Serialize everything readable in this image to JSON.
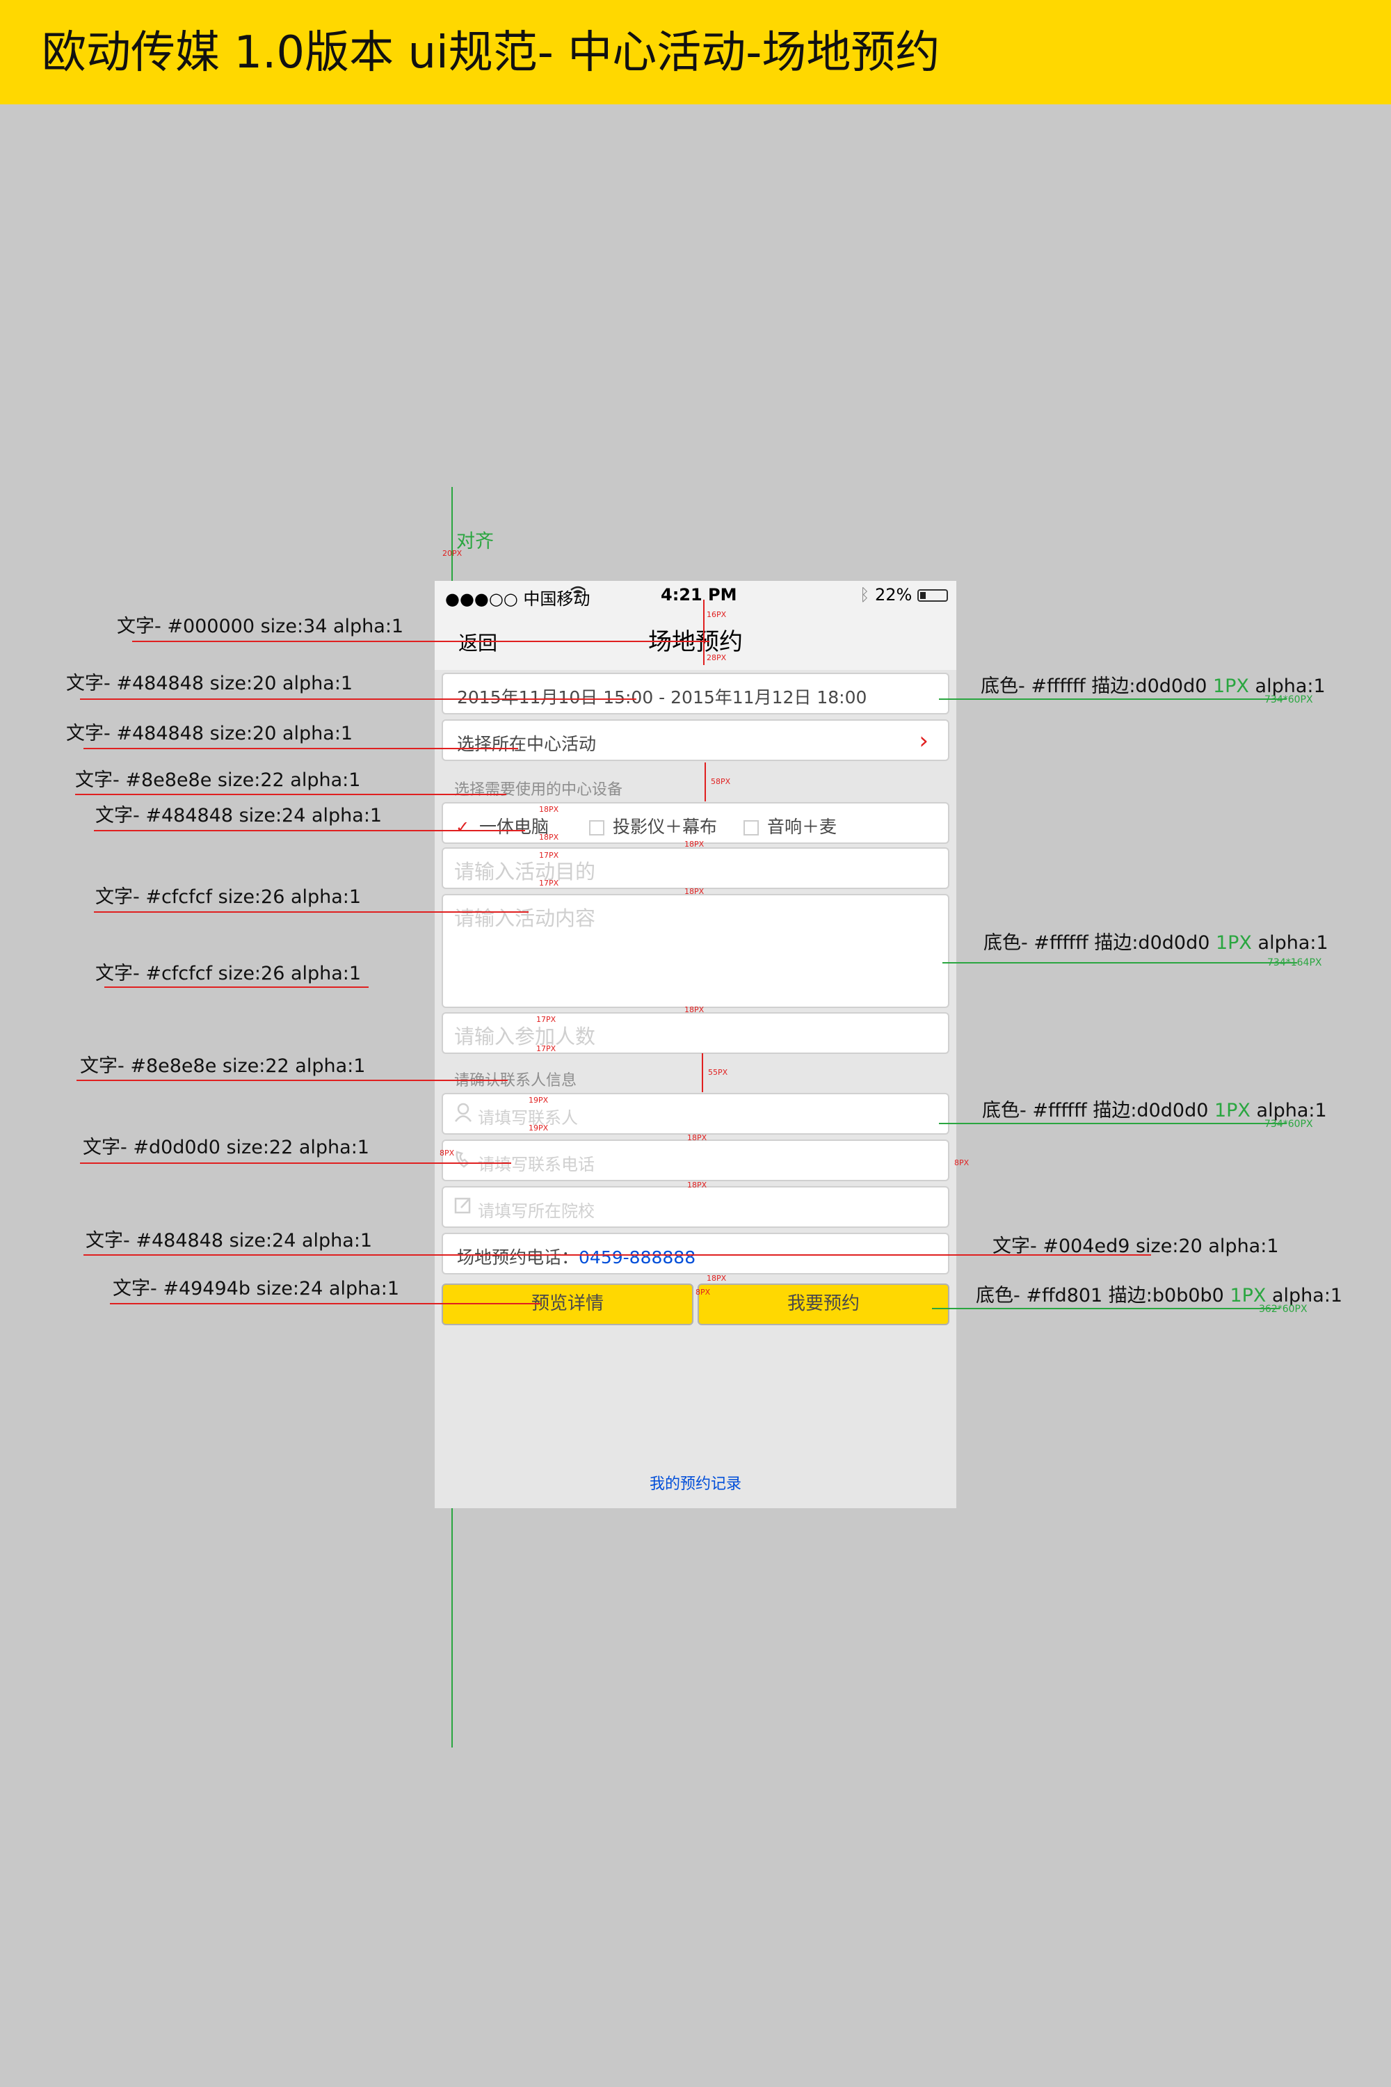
{
  "page": {
    "title": "欧动传媒 1.0版本 ui规范- 中心活动-场地预约",
    "align_label": "对齐"
  },
  "colors": {
    "banner": "#ffd800",
    "canvas": "#c8c8c8",
    "accent": "#ffd801",
    "link": "#004ed9",
    "guide": "#2aa640",
    "marker": "#e02020"
  },
  "status_bar": {
    "carrier": "●●●○○ 中国移动",
    "wifi_icon": "wifi-icon",
    "time": "4:21 PM",
    "bluetooth_icon": "bluetooth-icon",
    "battery": "22%"
  },
  "nav": {
    "back": "返回",
    "title": "场地预约"
  },
  "form": {
    "date_range": "2015年11月10日 15:00 - 2015年11月12日 18:00",
    "select_activity": "选择所在中心活动",
    "equipment_label": "选择需要使用的中心设备",
    "equipment": [
      {
        "label": "一体电脑",
        "checked": true
      },
      {
        "label": "投影仪＋幕布",
        "checked": false
      },
      {
        "label": "音响＋麦",
        "checked": false
      }
    ],
    "purpose_placeholder": "请输入活动目的",
    "content_placeholder": "请输入活动内容",
    "participants_placeholder": "请输入参加人数",
    "contact_label": "请确认联系人信息",
    "contact_name_placeholder": "请填写联系人",
    "contact_phone_placeholder": "请填写联系电话",
    "school_placeholder": "请填写所在院校",
    "venue_phone_label": "场地预约电话：",
    "venue_phone_number": "0459-888888",
    "preview_button": "预览详情",
    "book_button": "我要预约",
    "my_records": "我的预约记录"
  },
  "annotations": {
    "left": [
      "文字- #000000 size:34 alpha:1",
      "文字- #484848 size:20 alpha:1",
      "文字- #484848 size:20 alpha:1",
      "文字- #8e8e8e size:22 alpha:1",
      "文字- #484848 size:24 alpha:1",
      "文字- #cfcfcf size:26 alpha:1",
      "文字- #cfcfcf size:26 alpha:1",
      "文字- #8e8e8e size:22 alpha:1",
      "文字- #d0d0d0 size:22 alpha:1",
      "文字- #484848 size:24 alpha:1",
      "文字- #49494b size:24 alpha:1"
    ],
    "right": [
      {
        "prefix": "底色- #ffffff 描边:d0d0d0 ",
        "stroke": "1PX",
        "suffix": " alpha:1",
        "size": "734*60PX"
      },
      {
        "prefix": "底色- #ffffff 描边:d0d0d0 ",
        "stroke": "1PX",
        "suffix": " alpha:1",
        "size": "734*164PX"
      },
      {
        "prefix": "底色- #ffffff 描边:d0d0d0 ",
        "stroke": "1PX",
        "suffix": " alpha:1",
        "size": "734*60PX"
      },
      {
        "prefix": "文字- #004ed9 size:20 alpha:1",
        "stroke": "",
        "suffix": "",
        "size": ""
      },
      {
        "prefix": "底色- #ffd801 描边:b0b0b0 ",
        "stroke": "1PX",
        "suffix": " alpha:1",
        "size": "362*60PX"
      }
    ],
    "spacing": [
      "16PX",
      "28PX",
      "58PX",
      "18PX",
      "18PX",
      "18PX",
      "17PX",
      "17PX",
      "18PX",
      "18PX",
      "17PX",
      "17PX",
      "55PX",
      "19PX",
      "19PX",
      "18PX",
      "18PX",
      "8PX",
      "8PX",
      "18PX",
      "8PX",
      "20PX"
    ]
  }
}
